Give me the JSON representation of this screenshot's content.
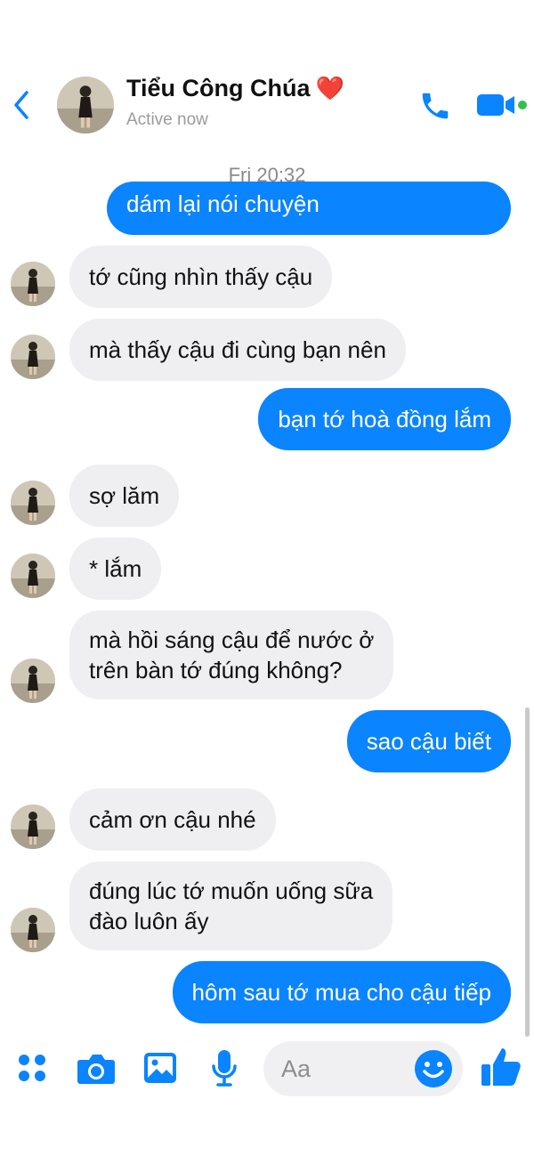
{
  "header": {
    "name": "Tiểu Công Chúa",
    "heart": "❤️",
    "status": "Active now",
    "icons": [
      "chevron-left-icon",
      "phone-icon",
      "video-camera-icon"
    ]
  },
  "timestamp": "Fri 20:32",
  "messages": [
    {
      "from": "me",
      "text": "dám lại nói chuyện"
    },
    {
      "from": "them",
      "text": "tớ cũng nhìn thấy cậu"
    },
    {
      "from": "them",
      "text": "mà thấy cậu đi cùng bạn nên"
    },
    {
      "from": "me",
      "text": "bạn tớ hoà đồng lắm"
    },
    {
      "from": "them",
      "text": "sợ lăm"
    },
    {
      "from": "them",
      "text": "* lắm"
    },
    {
      "from": "them",
      "line1": "mà hồi sáng cậu để nước ở",
      "line2": "trên bàn tớ đúng không?"
    },
    {
      "from": "me",
      "text": "sao cậu biết"
    },
    {
      "from": "them",
      "text": "cảm ơn cậu nhé"
    },
    {
      "from": "them",
      "line1": "đúng lúc tớ muốn uống sữa",
      "line2": "đào luôn ấy"
    },
    {
      "from": "me",
      "text": "hôm sau tớ mua cho cậu tiếp"
    }
  ],
  "composer": {
    "placeholder": "Aa",
    "icons": [
      "apps-grid-icon",
      "camera-icon",
      "image-icon",
      "microphone-icon",
      "emoji-icon",
      "thumbs-up-icon"
    ]
  },
  "colors": {
    "accent": "#0a84ff",
    "incoming_bubble": "#efeff1",
    "heart": "#e0202a"
  }
}
